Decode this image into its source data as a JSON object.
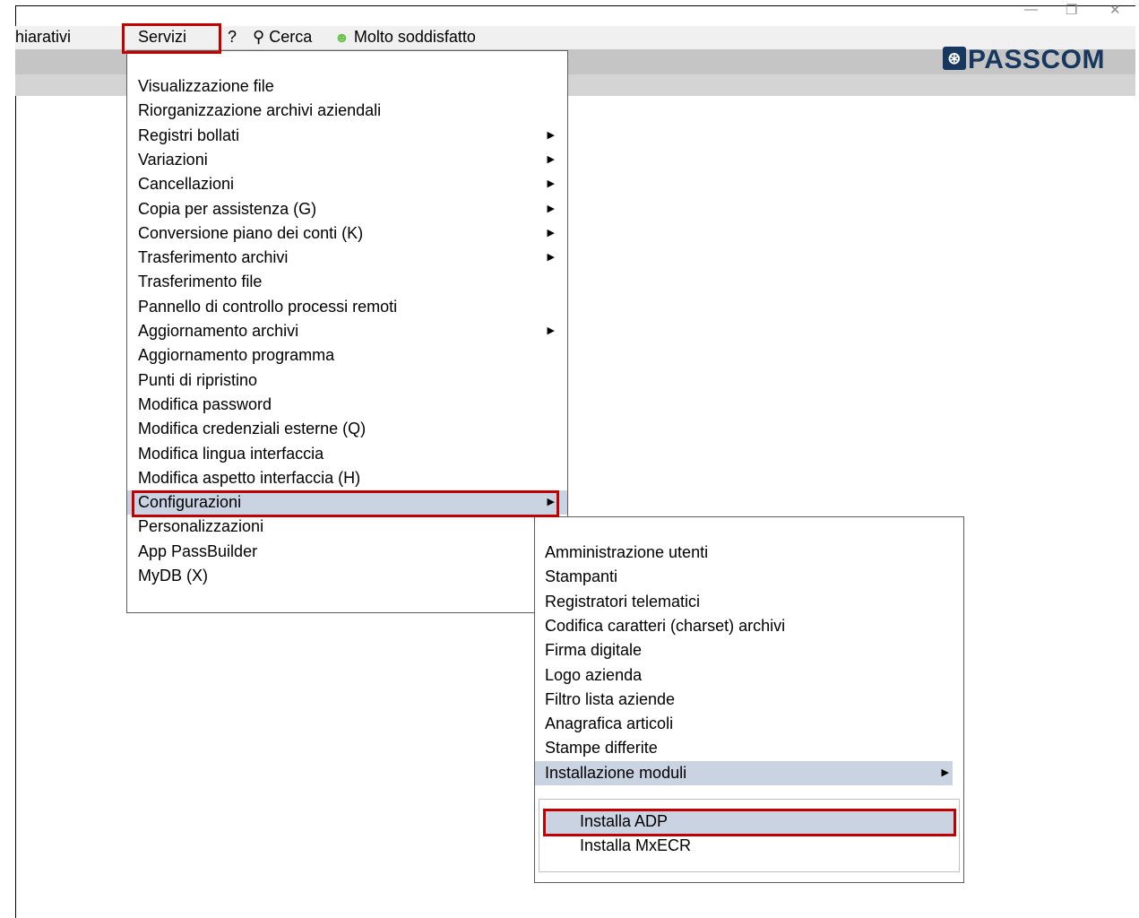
{
  "window": {
    "controls": [
      "—",
      "❐",
      "✕"
    ]
  },
  "menubar": {
    "left_fragment": "hiarativi",
    "servizi": "Servizi",
    "help": "?",
    "search_label": "Cerca",
    "feedback_label": "Molto soddisfatto"
  },
  "logo": {
    "badge": "⊛",
    "text": "PASSCOM"
  },
  "servizi_menu": [
    {
      "label": "Visualizzazione file",
      "arrow": false
    },
    {
      "label": "Riorganizzazione archivi aziendali",
      "arrow": false
    },
    {
      "label": "Registri bollati",
      "arrow": true
    },
    {
      "label": "Variazioni",
      "arrow": true
    },
    {
      "label": "Cancellazioni",
      "arrow": true
    },
    {
      "label": "Copia per assistenza (G)",
      "arrow": true
    },
    {
      "label": "Conversione piano dei conti (K)",
      "arrow": true
    },
    {
      "label": "Trasferimento archivi",
      "arrow": true
    },
    {
      "label": "Trasferimento file",
      "arrow": false
    },
    {
      "label": "Pannello di controllo processi remoti",
      "arrow": false
    },
    {
      "label": "Aggiornamento archivi",
      "arrow": true
    },
    {
      "label": "Aggiornamento programma",
      "arrow": false
    },
    {
      "label": "Punti di ripristino",
      "arrow": false
    },
    {
      "label": "Modifica password",
      "arrow": false
    },
    {
      "label": "Modifica credenziali esterne (Q)",
      "arrow": false
    },
    {
      "label": "Modifica lingua interfaccia",
      "arrow": false
    },
    {
      "label": "Modifica aspetto interfaccia (H)",
      "arrow": false
    },
    {
      "label": "Configurazioni",
      "arrow": true,
      "active": true
    },
    {
      "label": "Personalizzazioni",
      "arrow": false
    },
    {
      "label": "App PassBuilder",
      "arrow": false
    },
    {
      "label": "MyDB (X)",
      "arrow": false
    }
  ],
  "configurazioni_menu": [
    {
      "label": "Amministrazione utenti",
      "arrow": false
    },
    {
      "label": "Stampanti",
      "arrow": false
    },
    {
      "label": "Registratori telematici",
      "arrow": false
    },
    {
      "label": "Codifica caratteri (charset) archivi",
      "arrow": false
    },
    {
      "label": "Firma digitale",
      "arrow": false
    },
    {
      "label": "Logo azienda",
      "arrow": false
    },
    {
      "label": "Filtro lista aziende",
      "arrow": false
    },
    {
      "label": "Anagrafica articoli",
      "arrow": false
    },
    {
      "label": "Stampe differite",
      "arrow": false
    },
    {
      "label": "Installazione moduli",
      "arrow": true,
      "active": true
    }
  ],
  "installazione_menu": [
    {
      "label": "Installa ADP",
      "active": true
    },
    {
      "label": "Installa MxECR",
      "active": false
    }
  ],
  "colors": {
    "highlight_border": "#c00000",
    "active_item": "#c9d3e2",
    "logo": "#17375e"
  }
}
